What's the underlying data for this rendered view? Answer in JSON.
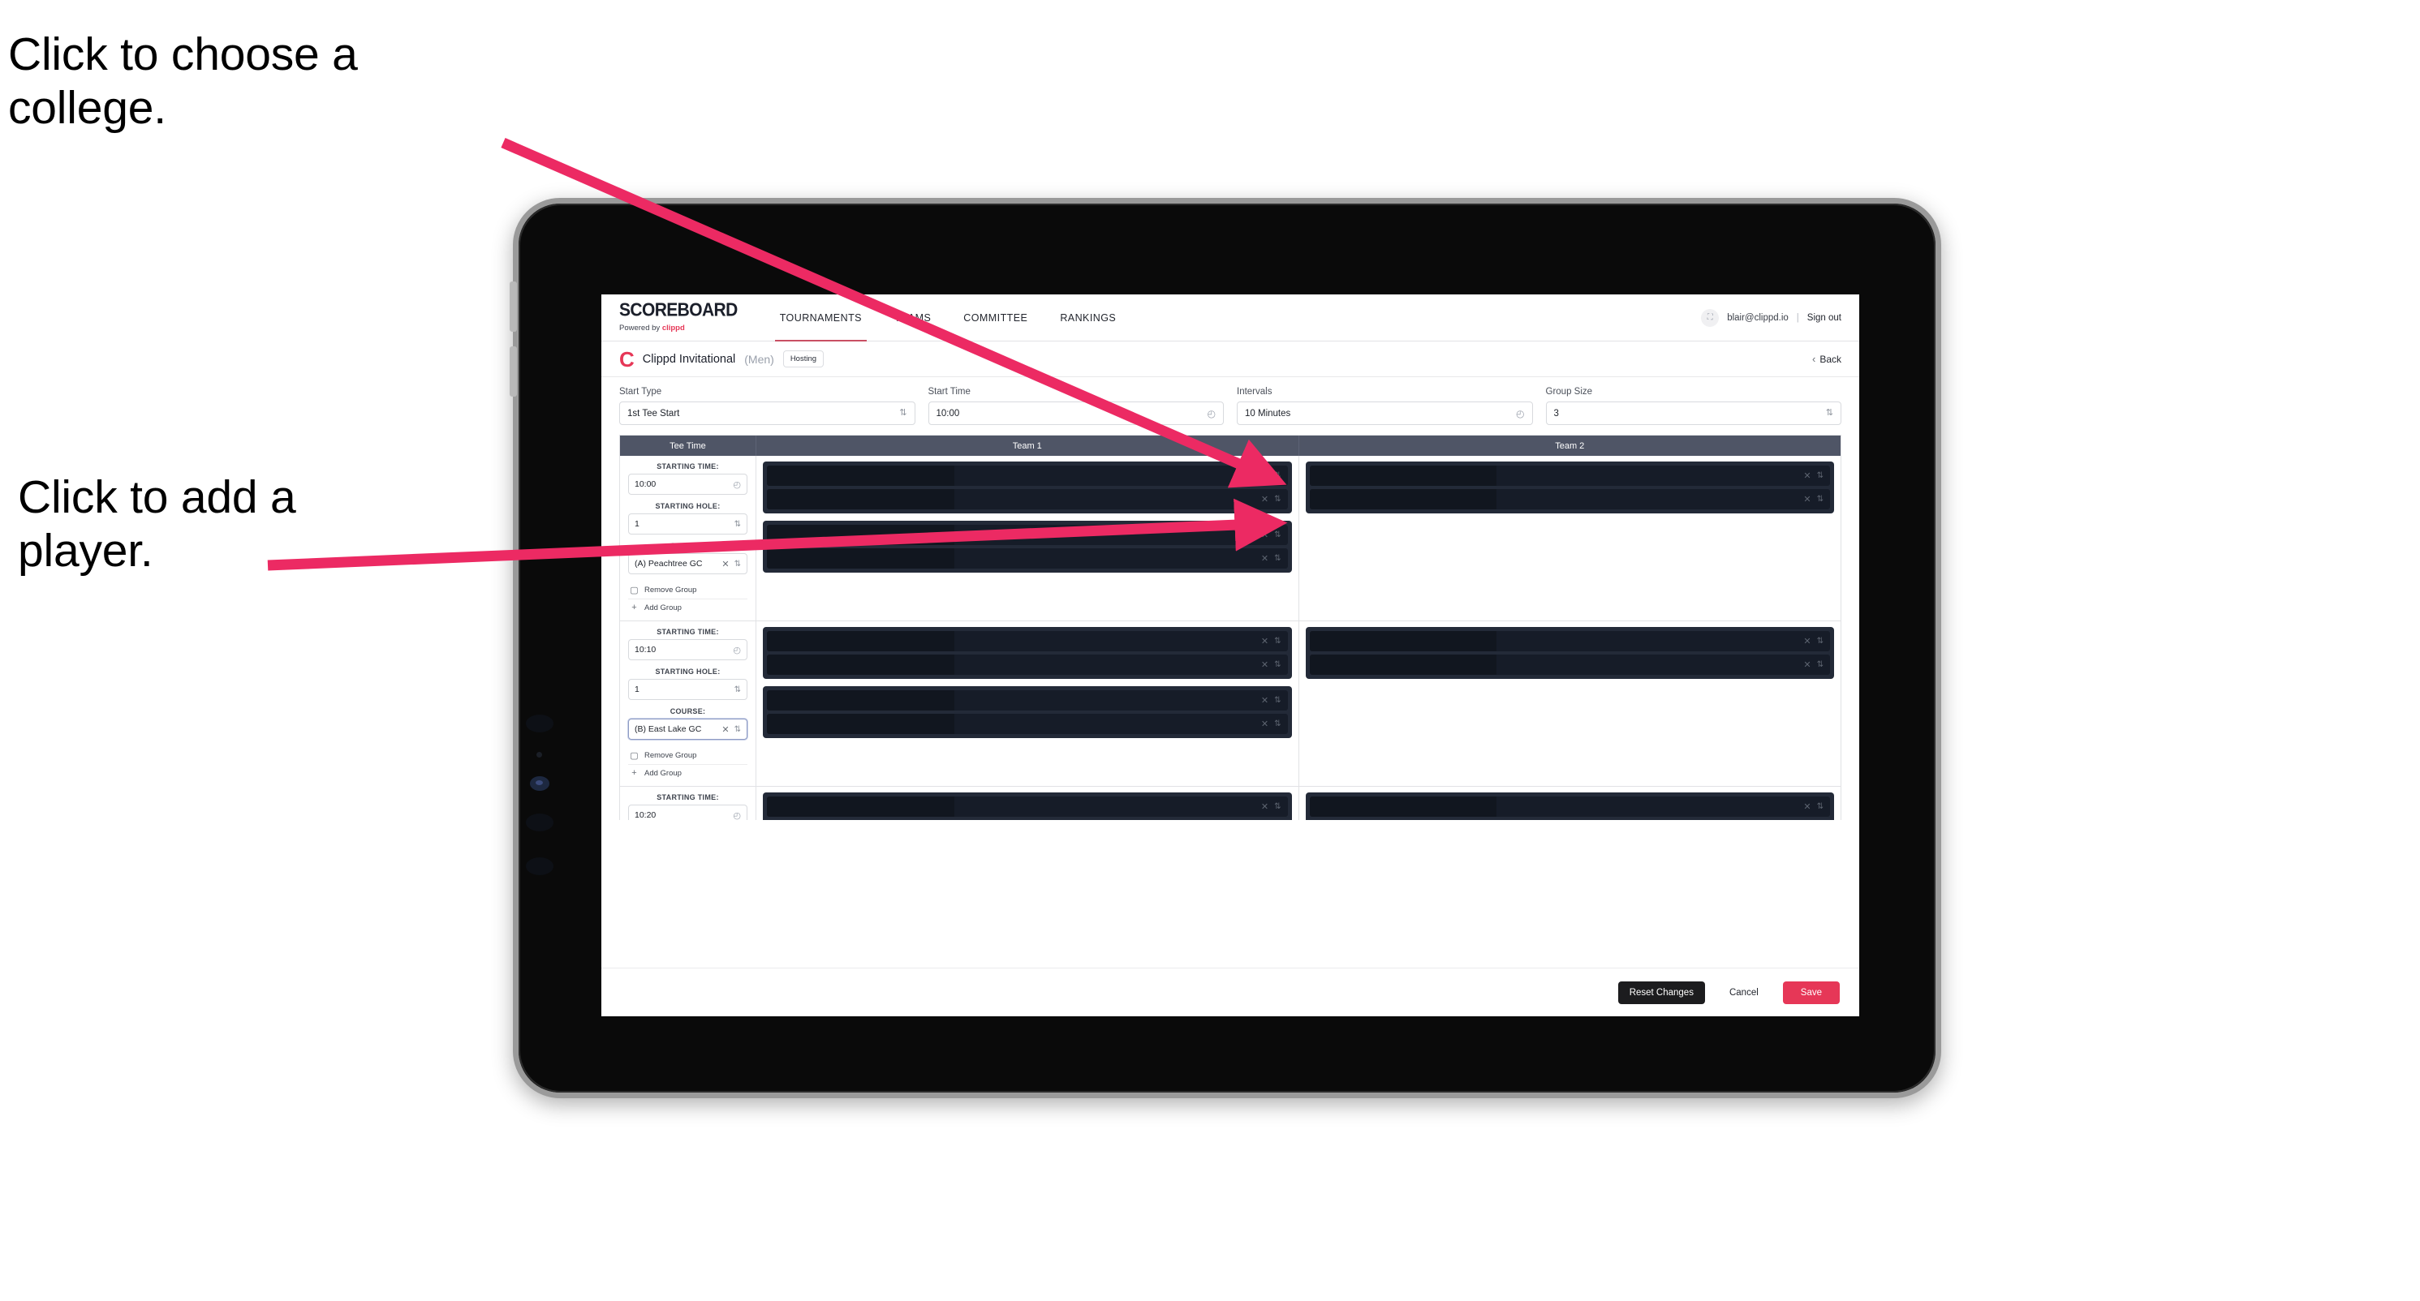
{
  "annotations": {
    "college": "Click to choose a college.",
    "player": "Click to add a player.",
    "arrow_color": "#ec2a63"
  },
  "app": {
    "brand": {
      "name": "SCOREBOARD",
      "powered_prefix": "Powered by ",
      "powered_brand": "clippd"
    },
    "nav": [
      {
        "label": "TOURNAMENTS",
        "active": true
      },
      {
        "label": "TEAMS",
        "active": false
      },
      {
        "label": "COMMITTEE",
        "active": false
      },
      {
        "label": "RANKINGS",
        "active": false
      }
    ],
    "account": {
      "avatar_glyph": "⛶",
      "email": "blair@clippd.io",
      "separator": "|",
      "sign_out": "Sign out"
    },
    "tournament": {
      "logo_letter": "C",
      "name": "Clippd Invitational",
      "gender": "(Men)",
      "status_badge": "Hosting",
      "back_label": "Back",
      "back_chevron": "‹"
    },
    "settings": [
      {
        "label": "Start Type",
        "value": "1st Tee Start",
        "control": "select"
      },
      {
        "label": "Start Time",
        "value": "10:00",
        "control": "time"
      },
      {
        "label": "Intervals",
        "value": "10 Minutes",
        "control": "time"
      },
      {
        "label": "Group Size",
        "value": "3",
        "control": "select"
      }
    ],
    "grid": {
      "columns": [
        "Tee Time",
        "Team 1",
        "Team 2"
      ],
      "labels": {
        "starting_time": "STARTING TIME:",
        "starting_hole": "STARTING HOLE:",
        "course": "COURSE:",
        "remove_group": "Remove Group",
        "add_group": "Add Group"
      },
      "icons": {
        "clock": "◴",
        "stepper": "⇅",
        "clear": "✕",
        "trash": "Ὕ1",
        "plus": "+"
      },
      "groups": [
        {
          "starting_time": "10:00",
          "starting_hole": "1",
          "course": "(A) Peachtree GC",
          "course_focused": false,
          "team1_players": 2,
          "team2_players": 2
        },
        {
          "starting_time": "10:10",
          "starting_hole": "1",
          "course": "(B) East Lake GC",
          "course_focused": true,
          "team1_players": 2,
          "team2_players": 2
        },
        {
          "starting_time": "10:20",
          "starting_hole": "",
          "course": "",
          "course_focused": false,
          "team1_players": 2,
          "team2_players": 2
        }
      ]
    },
    "footer": {
      "reset": "Reset Changes",
      "cancel": "Cancel",
      "save": "Save"
    },
    "colors": {
      "accent_pink": "#e63757",
      "header_slate": "#4f5566",
      "player_dark": "#232a38"
    }
  }
}
